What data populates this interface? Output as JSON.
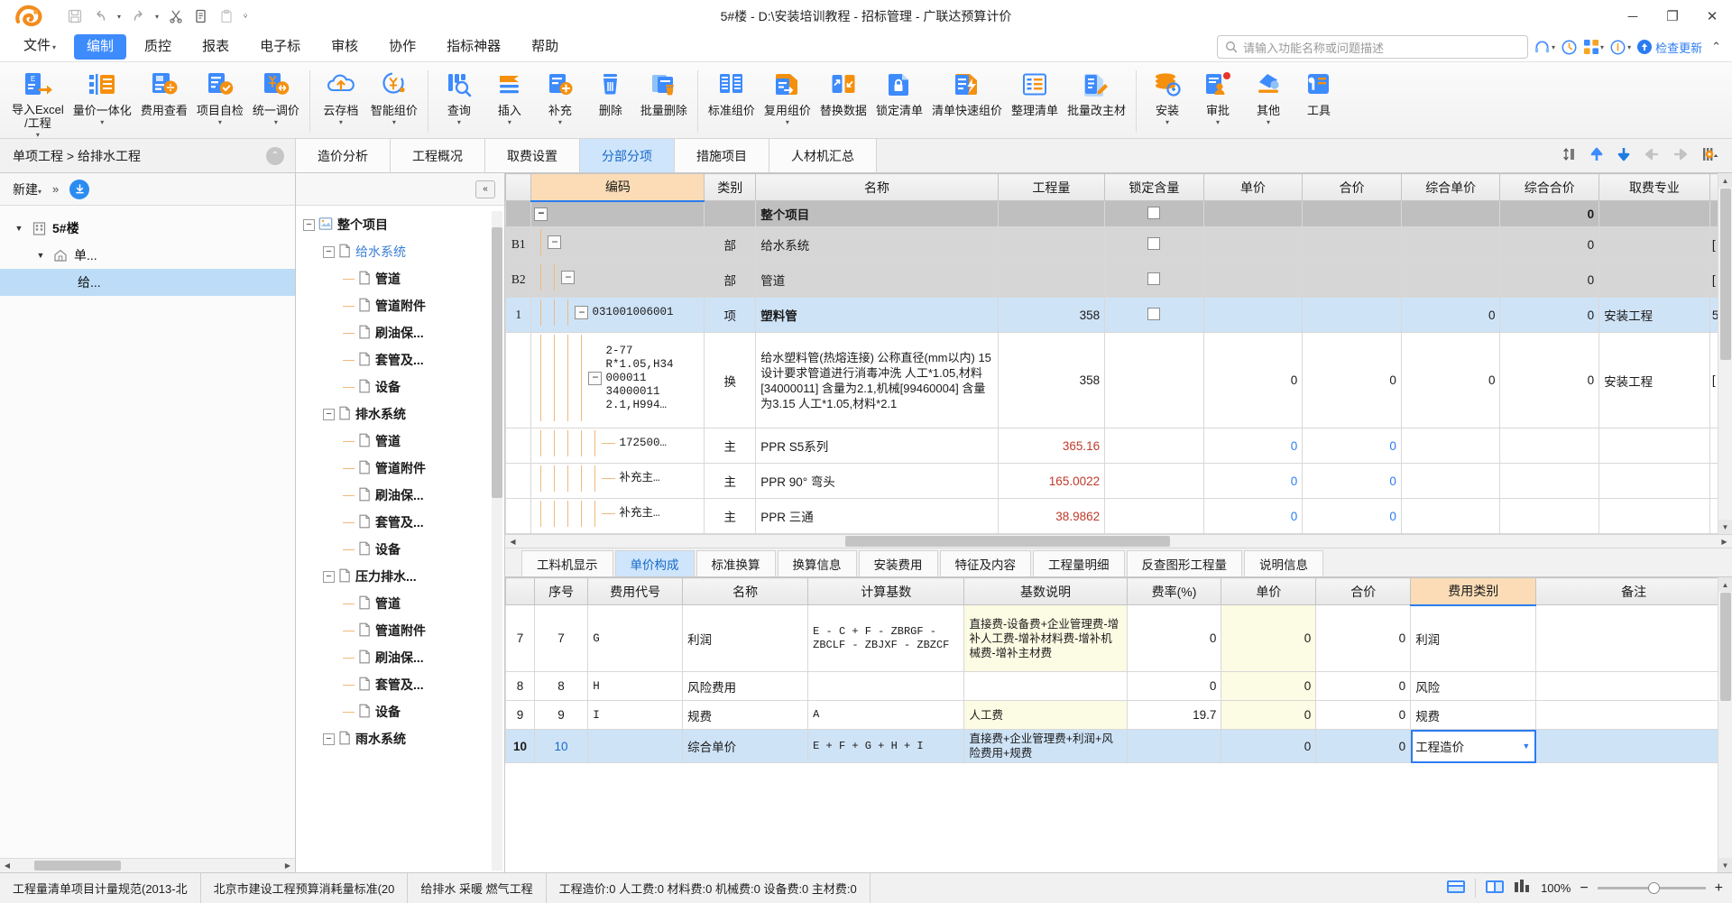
{
  "titlebar": {
    "title": "5#楼 - D:\\安装培训教程 - 招标管理 - 广联达预算计价",
    "quick_access": [
      {
        "name": "save-icon",
        "label": "保存"
      },
      {
        "name": "undo-icon",
        "label": "撤销"
      },
      {
        "name": "redo-icon",
        "label": "恢复"
      },
      {
        "name": "cut-icon",
        "label": "剪切"
      },
      {
        "name": "copy-icon",
        "label": "复制"
      },
      {
        "name": "paste-icon",
        "label": "粘贴"
      }
    ],
    "window_buttons": {
      "minimize": "─",
      "maximize": "❐",
      "close": "✕"
    }
  },
  "menubar": {
    "items": [
      {
        "label": "文件",
        "has_caret": true,
        "active": false
      },
      {
        "label": "编制",
        "has_caret": false,
        "active": true
      },
      {
        "label": "质控",
        "has_caret": false,
        "active": false
      },
      {
        "label": "报表",
        "has_caret": false,
        "active": false
      },
      {
        "label": "电子标",
        "has_caret": false,
        "active": false
      },
      {
        "label": "审核",
        "has_caret": false,
        "active": false
      },
      {
        "label": "协作",
        "has_caret": false,
        "active": false
      },
      {
        "label": "指标神器",
        "has_caret": false,
        "active": false
      },
      {
        "label": "帮助",
        "has_caret": false,
        "active": false
      }
    ],
    "search_placeholder": "请输入功能名称或问题描述",
    "update_label": "检查更新",
    "right_icons": [
      "headset-icon",
      "clock-icon",
      "apps-icon",
      "info-icon"
    ]
  },
  "ribbon": {
    "items": [
      {
        "label": "导入Excel",
        "label2": "/工程",
        "icon": "import-excel-icon",
        "caret": true
      },
      {
        "label": "量价一体化",
        "icon": "quantity-price-icon",
        "caret": true
      },
      {
        "label": "费用查看",
        "icon": "fee-view-icon",
        "caret": false
      },
      {
        "label": "项目自检",
        "icon": "self-check-icon",
        "caret": true
      },
      {
        "label": "统一调价",
        "icon": "unified-price-icon",
        "caret": true
      },
      {
        "label": "云存档",
        "icon": "cloud-archive-icon",
        "caret": true
      },
      {
        "label": "智能组价",
        "icon": "smart-price-icon",
        "caret": true
      },
      {
        "label": "查询",
        "icon": "query-icon",
        "caret": true
      },
      {
        "label": "插入",
        "icon": "insert-icon",
        "caret": true
      },
      {
        "label": "补充",
        "icon": "supplement-icon",
        "caret": true
      },
      {
        "label": "删除",
        "icon": "delete-icon",
        "caret": false
      },
      {
        "label": "批量删除",
        "icon": "batch-delete-icon",
        "caret": false
      },
      {
        "label": "标准组价",
        "icon": "standard-price-icon",
        "caret": false
      },
      {
        "label": "复用组价",
        "icon": "reuse-price-icon",
        "caret": true
      },
      {
        "label": "替换数据",
        "icon": "replace-data-icon",
        "caret": false
      },
      {
        "label": "锁定清单",
        "icon": "lock-list-icon",
        "caret": false
      },
      {
        "label": "清单快速组价",
        "icon": "quick-price-icon",
        "caret": false
      },
      {
        "label": "整理清单",
        "icon": "organize-list-icon",
        "caret": false
      },
      {
        "label": "批量改主材",
        "icon": "batch-material-icon",
        "caret": false
      },
      {
        "label": "安装",
        "icon": "install-icon",
        "caret": true
      },
      {
        "label": "审批",
        "icon": "approval-icon",
        "caret": true
      },
      {
        "label": "其他",
        "icon": "other-icon",
        "caret": true
      },
      {
        "label": "工具",
        "icon": "tools-icon",
        "caret": false
      }
    ]
  },
  "workspace": {
    "breadcrumb": "单项工程 > 给排水工程",
    "tabs": [
      {
        "label": "造价分析",
        "active": false
      },
      {
        "label": "工程概况",
        "active": false
      },
      {
        "label": "取费设置",
        "active": false
      },
      {
        "label": "分部分项",
        "active": true
      },
      {
        "label": "措施项目",
        "active": false
      },
      {
        "label": "人材机汇总",
        "active": false
      }
    ],
    "tools": [
      "sort-icon",
      "move-up-icon",
      "move-down-icon",
      "move-left-icon",
      "move-right-icon",
      "settings-icon"
    ]
  },
  "left_panel": {
    "new_label": "新建",
    "more_label": "»",
    "download_icon": "download-icon",
    "tree": [
      {
        "label": "5#楼",
        "indent": 0,
        "arrow": "down",
        "icon": "building-icon",
        "bold": true,
        "selected": false
      },
      {
        "label": "单...",
        "indent": 1,
        "arrow": "down",
        "icon": "home-icon",
        "bold": false,
        "selected": false
      },
      {
        "label": "给...",
        "indent": 2,
        "arrow": "none",
        "icon": "none",
        "bold": false,
        "selected": true
      }
    ]
  },
  "mid_tree": {
    "collapse_label": "«",
    "nodes": [
      {
        "label": "整个项目",
        "indent": 0,
        "toggle": "minus",
        "icon": "project-icon",
        "bold": true,
        "blue": false
      },
      {
        "label": "给水系统",
        "indent": 1,
        "toggle": "minus",
        "icon": "doc-icon",
        "bold": false,
        "blue": true
      },
      {
        "label": "管道",
        "indent": 2,
        "toggle": "none",
        "icon": "doc-icon",
        "bold": true,
        "blue": false
      },
      {
        "label": "管道附件",
        "indent": 2,
        "toggle": "none",
        "icon": "doc-icon",
        "bold": true,
        "blue": false
      },
      {
        "label": "刷油保...",
        "indent": 2,
        "toggle": "none",
        "icon": "doc-icon",
        "bold": true,
        "blue": false
      },
      {
        "label": "套管及...",
        "indent": 2,
        "toggle": "none",
        "icon": "doc-icon",
        "bold": true,
        "blue": false
      },
      {
        "label": "设备",
        "indent": 2,
        "toggle": "none",
        "icon": "doc-icon",
        "bold": true,
        "blue": false
      },
      {
        "label": "排水系统",
        "indent": 1,
        "toggle": "minus",
        "icon": "doc-icon",
        "bold": true,
        "blue": false
      },
      {
        "label": "管道",
        "indent": 2,
        "toggle": "none",
        "icon": "doc-icon",
        "bold": true,
        "blue": false
      },
      {
        "label": "管道附件",
        "indent": 2,
        "toggle": "none",
        "icon": "doc-icon",
        "bold": true,
        "blue": false
      },
      {
        "label": "刷油保...",
        "indent": 2,
        "toggle": "none",
        "icon": "doc-icon",
        "bold": true,
        "blue": false
      },
      {
        "label": "套管及...",
        "indent": 2,
        "toggle": "none",
        "icon": "doc-icon",
        "bold": true,
        "blue": false
      },
      {
        "label": "设备",
        "indent": 2,
        "toggle": "none",
        "icon": "doc-icon",
        "bold": true,
        "blue": false
      },
      {
        "label": "压力排水...",
        "indent": 1,
        "toggle": "minus",
        "icon": "doc-icon",
        "bold": true,
        "blue": false
      },
      {
        "label": "管道",
        "indent": 2,
        "toggle": "none",
        "icon": "doc-icon",
        "bold": true,
        "blue": false
      },
      {
        "label": "管道附件",
        "indent": 2,
        "toggle": "none",
        "icon": "doc-icon",
        "bold": true,
        "blue": false
      },
      {
        "label": "刷油保...",
        "indent": 2,
        "toggle": "none",
        "icon": "doc-icon",
        "bold": true,
        "blue": false
      },
      {
        "label": "套管及...",
        "indent": 2,
        "toggle": "none",
        "icon": "doc-icon",
        "bold": true,
        "blue": false
      },
      {
        "label": "设备",
        "indent": 2,
        "toggle": "none",
        "icon": "doc-icon",
        "bold": true,
        "blue": false
      },
      {
        "label": "雨水系统",
        "indent": 1,
        "toggle": "minus",
        "icon": "doc-icon",
        "bold": true,
        "blue": false
      }
    ]
  },
  "top_grid": {
    "columns": [
      "",
      "编码",
      "类别",
      "名称",
      "工程量",
      "锁定含量",
      "单价",
      "合价",
      "综合单价",
      "综合合价",
      "取费专业",
      ""
    ],
    "rows": [
      {
        "seq": "",
        "code": "",
        "toggle": "minus",
        "depth": 0,
        "category": "",
        "name": "整个项目",
        "quantity": "",
        "lock": true,
        "price": "",
        "total": "",
        "comp_price": "",
        "comp_total": "0",
        "fee_type": "",
        "extra": "",
        "style": "total"
      },
      {
        "seq": "B1",
        "code": "",
        "toggle": "minus",
        "depth": 1,
        "category": "部",
        "name": "给水系统",
        "quantity": "",
        "lock": true,
        "price": "",
        "total": "",
        "comp_price": "",
        "comp_total": "0",
        "fee_type": "",
        "extra": "[",
        "style": "b"
      },
      {
        "seq": "B2",
        "code": "",
        "toggle": "minus",
        "depth": 2,
        "category": "部",
        "name": "管道",
        "quantity": "",
        "lock": true,
        "price": "",
        "total": "",
        "comp_price": "",
        "comp_total": "0",
        "fee_type": "",
        "extra": "[",
        "style": "b"
      },
      {
        "seq": "1",
        "code": "031001006001",
        "toggle": "minus",
        "depth": 3,
        "category": "项",
        "name": "塑料管",
        "quantity": "358",
        "lock": true,
        "price": "",
        "total": "",
        "comp_price": "0",
        "comp_total": "0",
        "fee_type": "安装工程",
        "extra": "5",
        "style": "sel"
      },
      {
        "seq": "",
        "code": "2-77\nR*1.05,H34\n000011\n34000011\n2.1,H994…",
        "toggle": "minus",
        "depth": 4,
        "category": "换",
        "name": "给水塑料管(热熔连接) 公称直径(mm以内) 15  设计要求管道进行消毒冲洗 人工*1.05,材料[34000011] 含量为2.1,机械[99460004] 含量为3.15  人工*1.05,材料*2.1",
        "quantity": "358",
        "lock": false,
        "price": "0",
        "total": "0",
        "comp_price": "0",
        "comp_total": "0",
        "fee_type": "安装工程",
        "extra": "[",
        "style": "tall"
      },
      {
        "seq": "",
        "code": "172500…",
        "toggle": "leaf",
        "depth": 5,
        "category": "主",
        "name": "PPR  S5系列",
        "quantity": "365.16",
        "lock": false,
        "price": "0",
        "total": "0",
        "comp_price": "",
        "comp_total": "",
        "fee_type": "",
        "extra": "",
        "style": "mat"
      },
      {
        "seq": "",
        "code": "补充主…",
        "toggle": "leaf",
        "depth": 5,
        "category": "主",
        "name": "PPR 90° 弯头",
        "quantity": "165.0022",
        "lock": false,
        "price": "0",
        "total": "0",
        "comp_price": "",
        "comp_total": "",
        "fee_type": "",
        "extra": "",
        "style": "mat"
      },
      {
        "seq": "",
        "code": "补充主…",
        "toggle": "leaf",
        "depth": 5,
        "category": "主",
        "name": "PPR 三通",
        "quantity": "38.9862",
        "lock": false,
        "price": "0",
        "total": "0",
        "comp_price": "",
        "comp_total": "",
        "fee_type": "",
        "extra": "",
        "style": "mat"
      }
    ]
  },
  "bottom_panel": {
    "tabs": [
      {
        "label": "工料机显示",
        "active": false
      },
      {
        "label": "单价构成",
        "active": true
      },
      {
        "label": "标准换算",
        "active": false
      },
      {
        "label": "换算信息",
        "active": false
      },
      {
        "label": "安装费用",
        "active": false
      },
      {
        "label": "特征及内容",
        "active": false
      },
      {
        "label": "工程量明细",
        "active": false
      },
      {
        "label": "反查图形工程量",
        "active": false
      },
      {
        "label": "说明信息",
        "active": false
      }
    ],
    "columns": [
      "",
      "序号",
      "费用代号",
      "名称",
      "计算基数",
      "基数说明",
      "费率(%)",
      "单价",
      "合价",
      "费用类别",
      "备注"
    ],
    "rows": [
      {
        "rowno": "7",
        "seq": "7",
        "fee_code": "G",
        "name": "利润",
        "basis": "E - C + F - ZBRGF - ZBCLF - ZBJXF - ZBZCF",
        "basis_desc": "直接费-设备费+企业管理费-增补人工费-增补材料费-增补机械费-增补主材费",
        "rate": "0",
        "price": "0",
        "total": "0",
        "fee_type": "利润",
        "remark": "",
        "selected": false
      },
      {
        "rowno": "8",
        "seq": "8",
        "fee_code": "H",
        "name": "风险费用",
        "basis": "",
        "basis_desc": "",
        "rate": "0",
        "price": "0",
        "total": "0",
        "fee_type": "风险",
        "remark": "",
        "selected": false
      },
      {
        "rowno": "9",
        "seq": "9",
        "fee_code": "I",
        "name": "规费",
        "basis": "A",
        "basis_desc": "人工费",
        "rate": "19.7",
        "price": "0",
        "total": "0",
        "fee_type": "规费",
        "remark": "",
        "selected": false
      },
      {
        "rowno": "10",
        "seq": "10",
        "fee_code": "",
        "name": "综合单价",
        "basis": "E + F + G + H + I",
        "basis_desc": "直接费+企业管理费+利润+风险费用+规费",
        "rate": "",
        "price": "0",
        "total": "0",
        "fee_type": "工程造价",
        "remark": "",
        "selected": true
      }
    ]
  },
  "statusbar": {
    "segments": [
      "工程量清单项目计量规范(2013-北",
      "北京市建设工程预算消耗量标准(20",
      "给排水 采暖 燃气工程",
      "工程造价:0 人工费:0 材料费:0 机械费:0 设备费:0 主材费:0"
    ],
    "zoom": "100%",
    "zoom_minus": "−",
    "zoom_plus": "+",
    "view_icons": [
      "grid-view-icon",
      "split-view-icon",
      "column-view-icon"
    ]
  }
}
